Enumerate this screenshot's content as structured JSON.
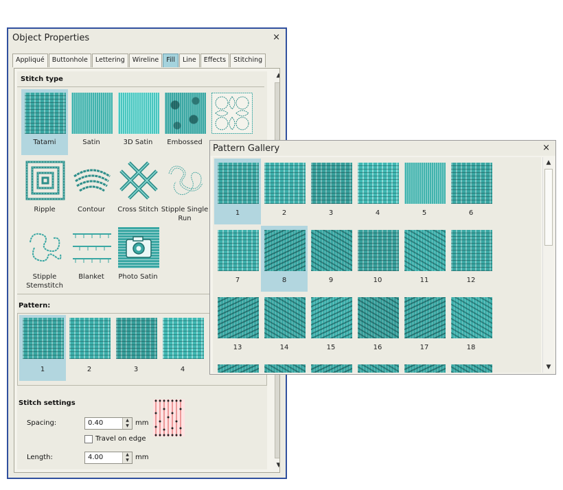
{
  "object_properties": {
    "title": "Object Properties",
    "close_glyph": "×",
    "tabs": [
      {
        "label": "Appliqué"
      },
      {
        "label": "Buttonhole"
      },
      {
        "label": "Lettering"
      },
      {
        "label": "Wireline"
      },
      {
        "label": "Fill",
        "active": true
      },
      {
        "label": "Line"
      },
      {
        "label": "Effects"
      },
      {
        "label": "Stitching"
      }
    ],
    "stitch_type": {
      "label": "Stitch type",
      "items": [
        {
          "label": "Tatami",
          "icon": "tatami-icon",
          "selected": true
        },
        {
          "label": "Satin",
          "icon": "satin-icon"
        },
        {
          "label": "3D Satin",
          "icon": "3d-satin-icon"
        },
        {
          "label": "Embossed",
          "icon": "embossed-icon"
        },
        {
          "label": "",
          "icon": "motif-fill-icon"
        },
        {
          "label": "Ripple",
          "icon": "ripple-icon"
        },
        {
          "label": "Contour",
          "icon": "contour-icon"
        },
        {
          "label": "Cross Stitch",
          "icon": "cross-stitch-icon"
        },
        {
          "label": "Stipple Single Run",
          "icon": "stipple-single-run-icon"
        },
        {
          "label": "Stipple Stemstitch",
          "icon": "stipple-stemstitch-icon"
        },
        {
          "label": "Blanket",
          "icon": "blanket-icon"
        },
        {
          "label": "Photo Satin",
          "icon": "photo-satin-icon"
        }
      ]
    },
    "pattern": {
      "label": "Pattern:",
      "items": [
        {
          "label": "1",
          "selected": true
        },
        {
          "label": "2"
        },
        {
          "label": "3"
        },
        {
          "label": "4"
        }
      ]
    },
    "stitch_settings": {
      "label": "Stitch settings",
      "spacing_label": "Spacing:",
      "spacing_value": "0.40",
      "spacing_unit": "mm",
      "travel_on_edge_label": "Travel on edge",
      "travel_on_edge_checked": false,
      "length_label": "Length:",
      "length_value": "4.00",
      "length_unit": "mm"
    }
  },
  "pattern_gallery": {
    "title": "Pattern Gallery",
    "close_glyph": "×",
    "items": [
      {
        "label": "1",
        "selected": true
      },
      {
        "label": "2"
      },
      {
        "label": "3"
      },
      {
        "label": "4"
      },
      {
        "label": "5"
      },
      {
        "label": "6"
      },
      {
        "label": "7"
      },
      {
        "label": "8",
        "selected": true
      },
      {
        "label": "9"
      },
      {
        "label": "10"
      },
      {
        "label": "11"
      },
      {
        "label": "12"
      },
      {
        "label": "13"
      },
      {
        "label": "14"
      },
      {
        "label": "15"
      },
      {
        "label": "16"
      },
      {
        "label": "17"
      },
      {
        "label": "18"
      }
    ]
  },
  "colors": {
    "accent_selection": "#b2d6df",
    "stitch_teal": "#3aa7a3",
    "window_border": "#2f4f9e",
    "stitch_preview": "#e06b6b"
  }
}
